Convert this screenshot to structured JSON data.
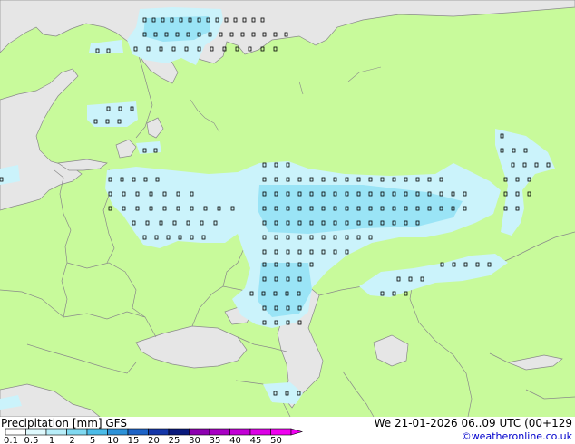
{
  "title": "Precipitation [mm]  GFS",
  "datetime": "We 21-01-2026 06..09 UTC (00+129",
  "credit": "©weatheronline.co.uk",
  "colors": {
    "land": "#c8fa9b",
    "water": "#e6e6e6",
    "border": "#8a8a8a",
    "coast": "#8a8a8a",
    "precip_light": "#cbf3fb",
    "precip_mid": "#9ae4f6"
  },
  "legend": [
    {
      "label": "0.1",
      "color": "#ffffff"
    },
    {
      "label": "0.5",
      "color": "#dff9fd"
    },
    {
      "label": "1",
      "color": "#b8eef9"
    },
    {
      "label": "2",
      "color": "#80d9f1"
    },
    {
      "label": "5",
      "color": "#4bbce8"
    },
    {
      "label": "10",
      "color": "#2d92d8"
    },
    {
      "label": "15",
      "color": "#1d63c6"
    },
    {
      "label": "20",
      "color": "#1436a8"
    },
    {
      "label": "25",
      "color": "#0a1a7d"
    },
    {
      "label": "30",
      "color": "#8d00b0"
    },
    {
      "label": "35",
      "color": "#a800c4"
    },
    {
      "label": "40",
      "color": "#c300d6"
    },
    {
      "label": "45",
      "color": "#dc00e6"
    },
    {
      "label": "50",
      "color": "#f000f0"
    }
  ]
}
